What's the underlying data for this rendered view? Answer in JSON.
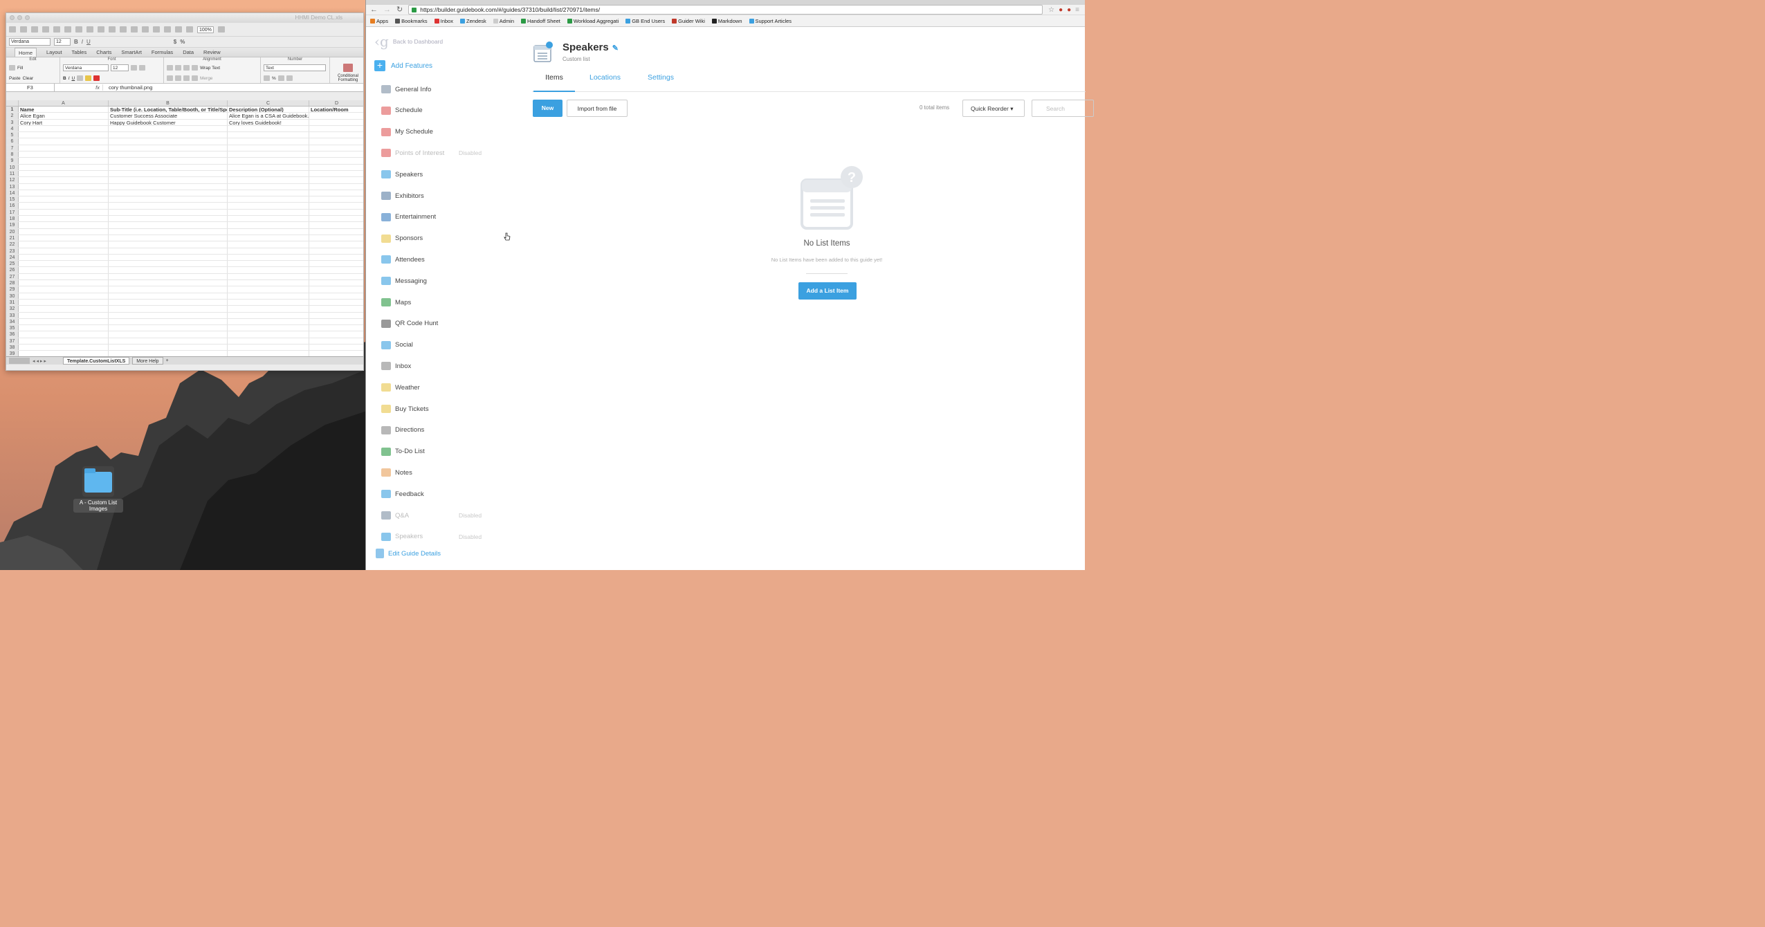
{
  "excel": {
    "window_title": "HHMI Demo CL.xls",
    "zoom": "100%",
    "font_name": "Verdana",
    "font_size": "12",
    "tabs": [
      "Home",
      "Layout",
      "Tables",
      "Charts",
      "SmartArt",
      "Formulas",
      "Data",
      "Review"
    ],
    "ribbon": {
      "edit_label": "Edit",
      "font_label": "Font",
      "alignment_label": "Alignment",
      "number_label": "Number",
      "paste": "Paste",
      "fill": "Fill",
      "clear": "Clear",
      "font": "Verdana",
      "size": "12",
      "wrap_text": "Wrap Text",
      "merge": "Merge",
      "number_format": "Text",
      "conditional": "Conditional Formatting"
    },
    "cell_ref": "F3",
    "formula_value": "cory thumbnail.png",
    "columns": [
      "A",
      "B",
      "C",
      "D"
    ],
    "rows": [
      [
        "Name",
        "Sub-Title (i.e. Location, Table/Booth, or Title/Sponsorship Level)",
        "Description (Optional)",
        "Location/Room"
      ],
      [
        "Alice Egan",
        "Customer Success Associate",
        "Alice Egan is a CSA at Guidebook.",
        ""
      ],
      [
        "Cory Hart",
        "Happy Guidebook Customer",
        "Cory loves Guidebook!",
        ""
      ]
    ],
    "row_count": 39,
    "sheets": [
      "Template.CustomListXLS",
      "More Help"
    ]
  },
  "desktop": {
    "folder_label": "A - Custom List Images"
  },
  "browser": {
    "url": "https://builder.guidebook.com/#/guides/37310/build/list/270971/items/",
    "bookmarks": [
      "Apps",
      "Bookmarks",
      "Inbox",
      "Zendesk",
      "Admin",
      "Handoff Sheet",
      "Workload Aggregati",
      "GB End Users",
      "Guider Wiki",
      "Markdown",
      "Support Articles"
    ]
  },
  "app": {
    "back_label": "Back to Dashboard",
    "add_features": "Add Features",
    "features": [
      {
        "label": "General Info",
        "disabled": ""
      },
      {
        "label": "Schedule",
        "disabled": ""
      },
      {
        "label": "My Schedule",
        "disabled": ""
      },
      {
        "label": "Points of Interest",
        "disabled": "Disabled"
      },
      {
        "label": "Speakers",
        "disabled": ""
      },
      {
        "label": "Exhibitors",
        "disabled": ""
      },
      {
        "label": "Entertainment",
        "disabled": ""
      },
      {
        "label": "Sponsors",
        "disabled": ""
      },
      {
        "label": "Attendees",
        "disabled": ""
      },
      {
        "label": "Messaging",
        "disabled": ""
      },
      {
        "label": "Maps",
        "disabled": ""
      },
      {
        "label": "QR Code Hunt",
        "disabled": ""
      },
      {
        "label": "Social",
        "disabled": ""
      },
      {
        "label": "Inbox",
        "disabled": ""
      },
      {
        "label": "Weather",
        "disabled": ""
      },
      {
        "label": "Buy Tickets",
        "disabled": ""
      },
      {
        "label": "Directions",
        "disabled": ""
      },
      {
        "label": "To-Do List",
        "disabled": ""
      },
      {
        "label": "Notes",
        "disabled": ""
      },
      {
        "label": "Feedback",
        "disabled": ""
      },
      {
        "label": "Q&A",
        "disabled": "Disabled"
      },
      {
        "label": "Speakers",
        "disabled": "Disabled"
      }
    ],
    "edit_guide": "Edit Guide Details",
    "page_title": "Speakers",
    "page_subtitle": "Custom list",
    "tabs": [
      "Items",
      "Locations",
      "Settings"
    ],
    "new_button": "New",
    "import_button": "Import from file",
    "total_items": "0 total items",
    "quick_reorder": "Quick Reorder",
    "search_placeholder": "Search",
    "empty_title": "No List Items",
    "empty_subtitle": "No List Items have been added to this guide yet!",
    "add_button": "Add a List Item",
    "accent": "#3ba0e0"
  }
}
